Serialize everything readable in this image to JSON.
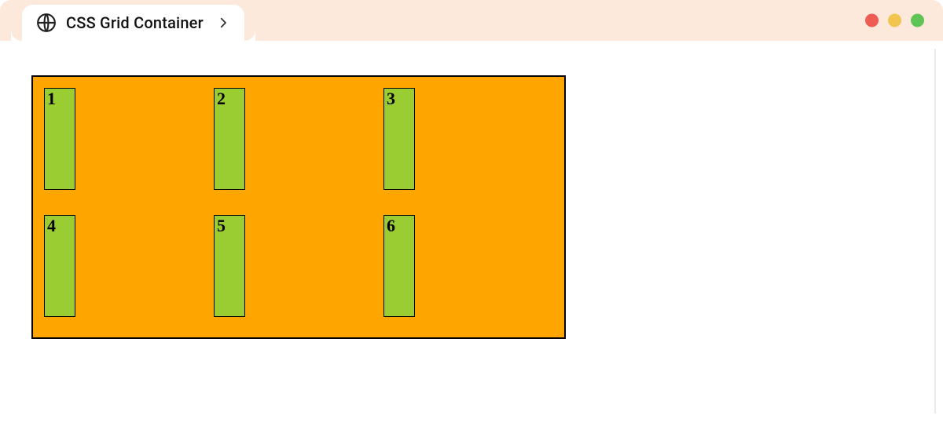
{
  "tab": {
    "title": "CSS Grid Container",
    "icon": "globe-icon",
    "chevron": "chevron-right-icon"
  },
  "window_controls": {
    "close": "close",
    "minimize": "minimize",
    "zoom": "zoom"
  },
  "grid": {
    "items": [
      "1",
      "2",
      "3",
      "4",
      "5",
      "6"
    ]
  }
}
